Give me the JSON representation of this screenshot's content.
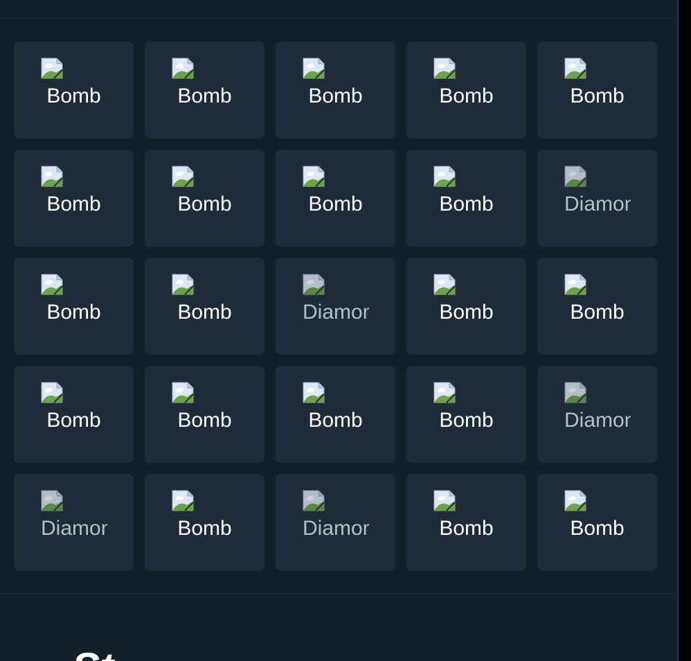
{
  "tiles": [
    {
      "kind": "bomb",
      "label": "Bomb"
    },
    {
      "kind": "bomb",
      "label": "Bomb"
    },
    {
      "kind": "bomb",
      "label": "Bomb"
    },
    {
      "kind": "bomb",
      "label": "Bomb"
    },
    {
      "kind": "bomb",
      "label": "Bomb"
    },
    {
      "kind": "bomb",
      "label": "Bomb"
    },
    {
      "kind": "bomb",
      "label": "Bomb"
    },
    {
      "kind": "bomb",
      "label": "Bomb"
    },
    {
      "kind": "bomb",
      "label": "Bomb"
    },
    {
      "kind": "diamond",
      "label": "Diamond"
    },
    {
      "kind": "bomb",
      "label": "Bomb"
    },
    {
      "kind": "bomb",
      "label": "Bomb"
    },
    {
      "kind": "diamond",
      "label": "Diamond"
    },
    {
      "kind": "bomb",
      "label": "Bomb"
    },
    {
      "kind": "bomb",
      "label": "Bomb"
    },
    {
      "kind": "bomb",
      "label": "Bomb"
    },
    {
      "kind": "bomb",
      "label": "Bomb"
    },
    {
      "kind": "bomb",
      "label": "Bomb"
    },
    {
      "kind": "bomb",
      "label": "Bomb"
    },
    {
      "kind": "diamond",
      "label": "Diamond"
    },
    {
      "kind": "diamond",
      "label": "Diamond"
    },
    {
      "kind": "bomb",
      "label": "Bomb"
    },
    {
      "kind": "diamond",
      "label": "Diamond"
    },
    {
      "kind": "bomb",
      "label": "Bomb"
    },
    {
      "kind": "bomb",
      "label": "Bomb"
    }
  ],
  "icons": {
    "tile_image": "broken-image-icon"
  },
  "colors": {
    "background": "#142029",
    "tile": "#1f2b37",
    "bomb_label": "#ffffff",
    "diamond_label": "#b7c0ca"
  },
  "bottom": {
    "heading": "St"
  }
}
